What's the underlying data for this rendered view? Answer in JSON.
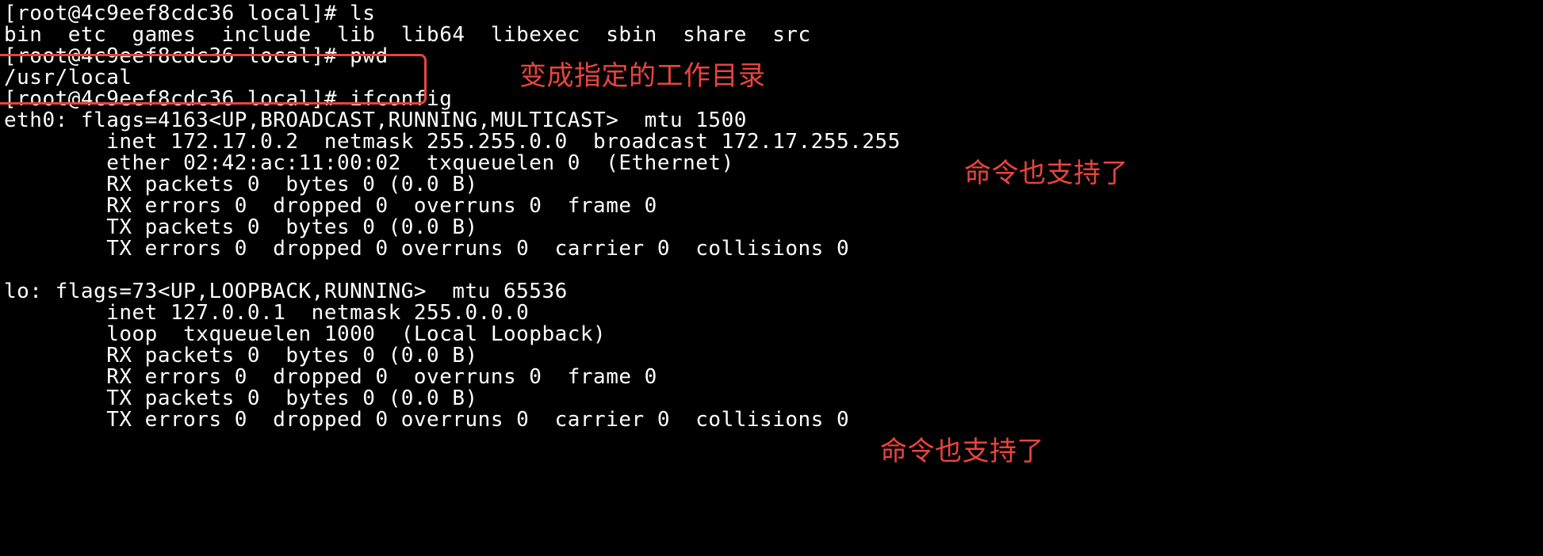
{
  "terminal": {
    "lines": [
      "[root@4c9eef8cdc36 local]# ls",
      "bin  etc  games  include  lib  lib64  libexec  sbin  share  src",
      "[root@4c9eef8cdc36 local]# pwd",
      "/usr/local",
      "[root@4c9eef8cdc36 local]# ifconfig",
      "eth0: flags=4163<UP,BROADCAST,RUNNING,MULTICAST>  mtu 1500",
      "        inet 172.17.0.2  netmask 255.255.0.0  broadcast 172.17.255.255",
      "        ether 02:42:ac:11:00:02  txqueuelen 0  (Ethernet)",
      "        RX packets 0  bytes 0 (0.0 B)",
      "        RX errors 0  dropped 0  overruns 0  frame 0",
      "        TX packets 0  bytes 0 (0.0 B)",
      "        TX errors 0  dropped 0 overruns 0  carrier 0  collisions 0",
      "",
      "lo: flags=73<UP,LOOPBACK,RUNNING>  mtu 65536",
      "        inet 127.0.0.1  netmask 255.0.0.0",
      "        loop  txqueuelen 1000  (Local Loopback)",
      "        RX packets 0  bytes 0 (0.0 B)",
      "        RX errors 0  dropped 0  overruns 0  frame 0",
      "        TX packets 0  bytes 0 (0.0 B)",
      "        TX errors 0  dropped 0 overruns 0  carrier 0  collisions 0"
    ]
  },
  "annotations": {
    "pwd_note": "变成指定的工作目录",
    "eth0_note": "命令也支持了",
    "lo_note": "命令也支持了"
  },
  "colors": {
    "background": "#000000",
    "text": "#ffffff",
    "annotation": "#e8453c"
  }
}
